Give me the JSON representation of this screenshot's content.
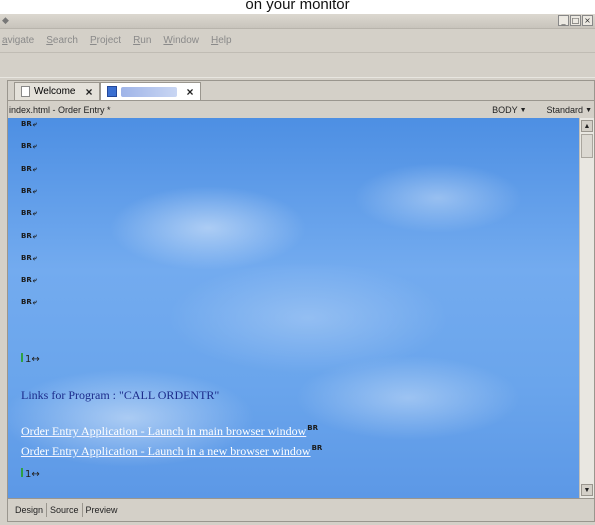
{
  "caption": "on your monitor",
  "window": {
    "controls": {
      "minimize": "_",
      "maximize": "□",
      "close": "×"
    }
  },
  "menu": [
    "avigate",
    "Search",
    "Project",
    "Run",
    "Window",
    "Help"
  ],
  "tabs": [
    {
      "label": "Welcome",
      "icon": "document-icon",
      "close": "×"
    },
    {
      "label": "",
      "icon": "html-file-icon",
      "close": "×"
    }
  ],
  "pathbar": {
    "file": "index.html - Order Entry *",
    "element": "BODY",
    "mode": "Standard"
  },
  "canvas": {
    "background": "sky-clouds",
    "line_break_marker": "BR",
    "line_break_count": 9,
    "anchor_marker": "1↔",
    "heading": "Links for Program : \"CALL ORDENTR\"",
    "links": [
      "Order Entry Application - Launch in main browser window",
      "Order Entry Application - Launch in a new browser window"
    ]
  },
  "bottom_tabs": [
    "Design",
    "Source",
    "Preview"
  ],
  "colors": {
    "link": "#ffffff",
    "heading": "#1b2a8a",
    "chrome": "#d4d0c8"
  }
}
